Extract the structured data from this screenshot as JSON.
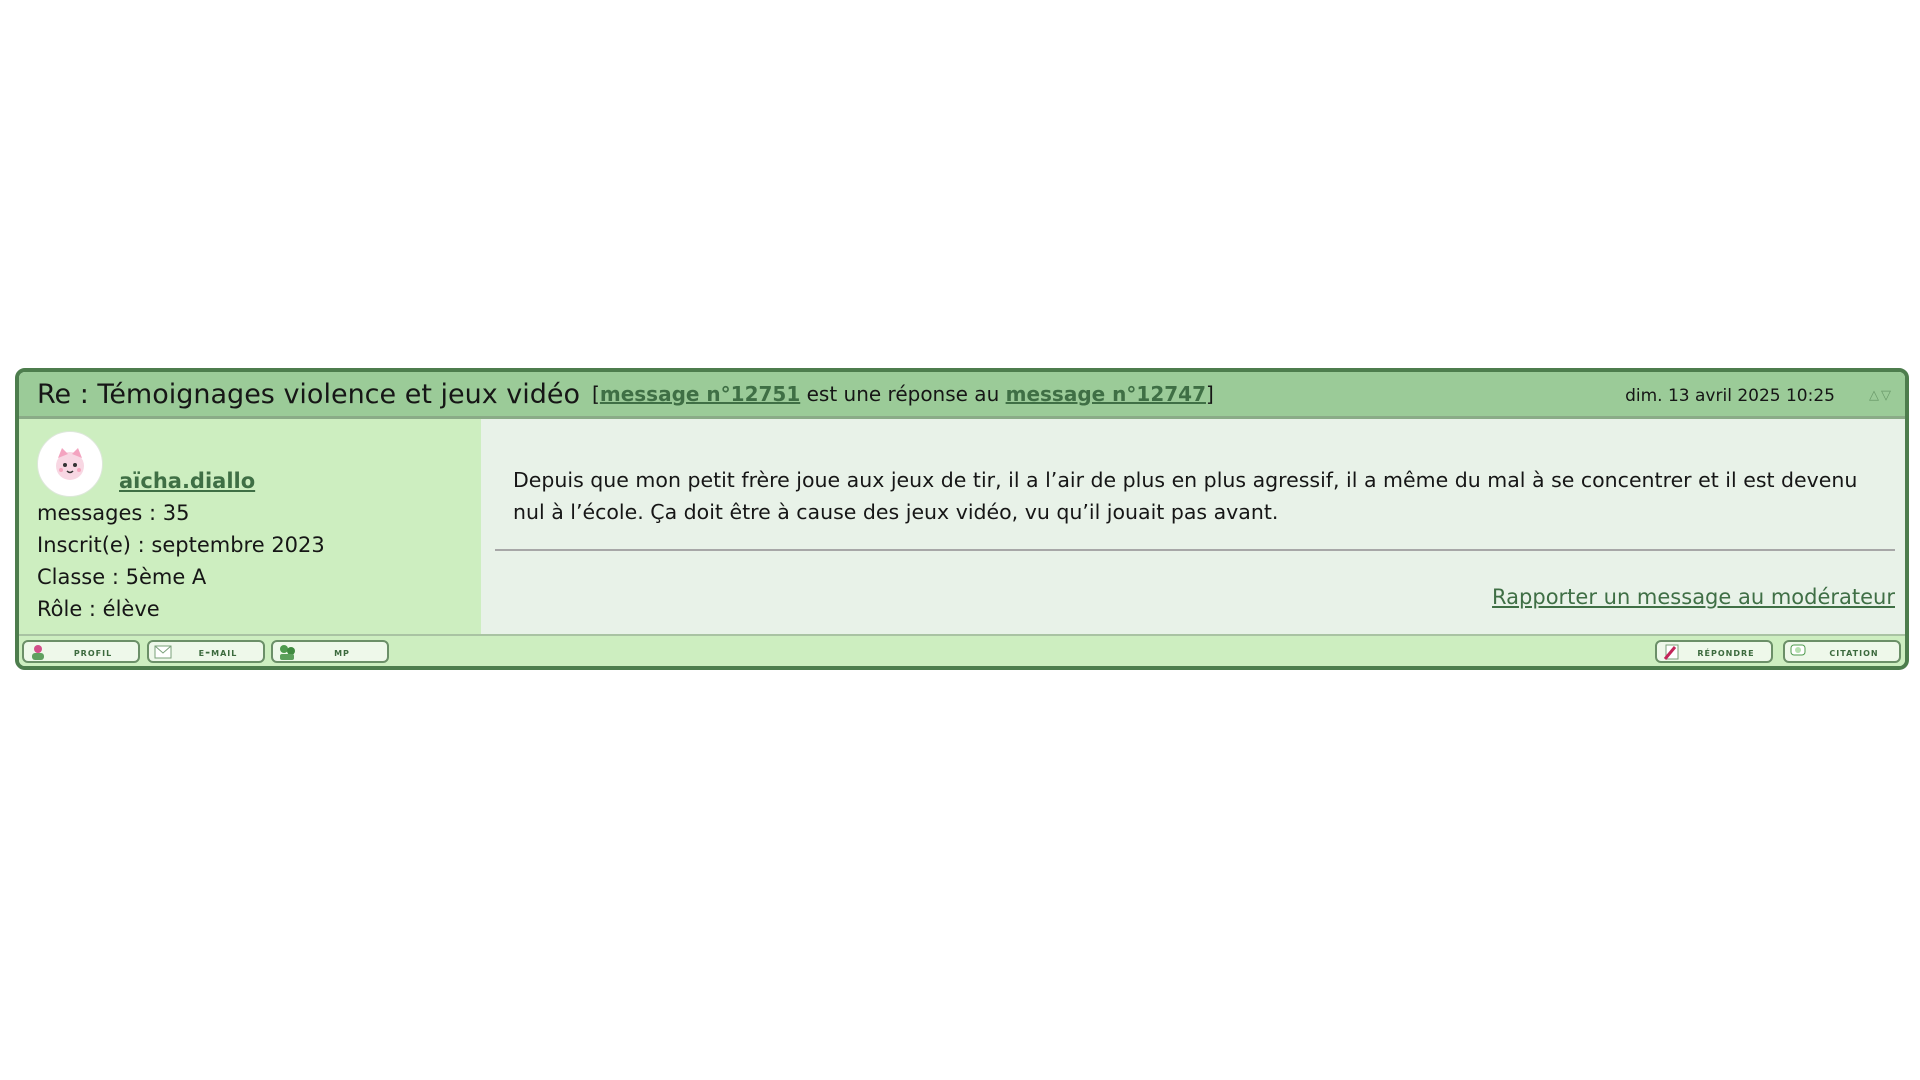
{
  "post": {
    "title": "Re : Témoignages violence et jeux vidéo",
    "reply_info": {
      "open_bracket": "[",
      "message_link": "message n°12751",
      "middle_text": " est une réponse au ",
      "parent_link": "message n°12747",
      "close_bracket": "]"
    },
    "date": "dim. 13 avril 2025 10:25",
    "author": {
      "username": "aïcha.diallo",
      "messages": "messages : 35",
      "registered": "Inscrit(e) : septembre 2023",
      "class": "Classe : 5ème A",
      "role": "Rôle : élève"
    },
    "message": "Depuis que mon petit frère joue aux jeux de tir, il a l’air de plus en plus agressif, il a même du mal à se concentrer et il est devenu nul à l’école. Ça doit être à cause des jeux vidéo, vu qu’il jouait pas avant.",
    "report_link": "Rapporter un message au modérateur",
    "buttons": {
      "profil": "profil",
      "email": "e-mail",
      "mp": "mp",
      "repondre": "répondre",
      "citation": "citation"
    },
    "icons": {
      "up": "chevron-up-icon",
      "down": "chevron-down-icon"
    }
  }
}
